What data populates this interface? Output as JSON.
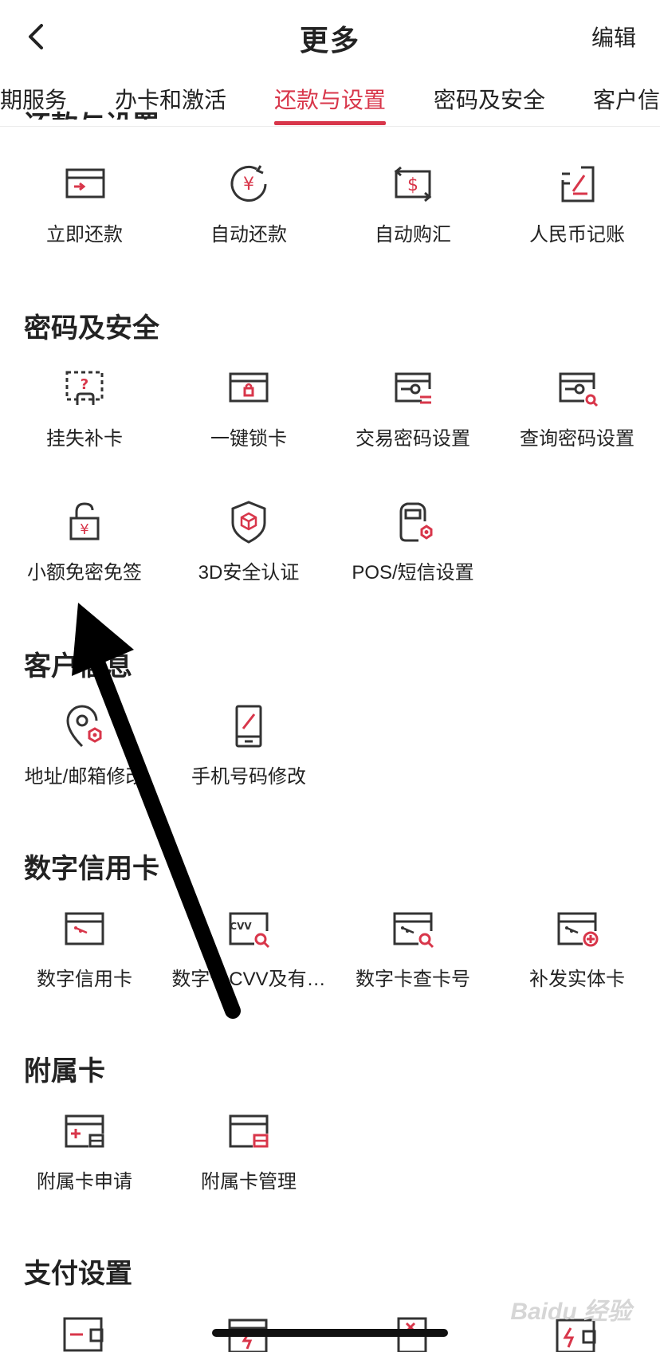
{
  "header": {
    "title": "更多",
    "edit_label": "编辑"
  },
  "tabs": [
    {
      "label": "期服务"
    },
    {
      "label": "办卡和激活"
    },
    {
      "label": "还款与设置",
      "active": true
    },
    {
      "label": "密码及安全"
    },
    {
      "label": "客户信"
    }
  ],
  "sections": {
    "repayment": {
      "title": "还款与设置",
      "items": [
        {
          "label": "立即还款",
          "icon": "repay-card-icon"
        },
        {
          "label": "自动还款",
          "icon": "auto-repay-yuan-icon"
        },
        {
          "label": "自动购汇",
          "icon": "auto-exchange-dollar-icon"
        },
        {
          "label": "人民币记账",
          "icon": "rmb-ledger-icon"
        }
      ]
    },
    "security": {
      "title": "密码及安全",
      "items": [
        {
          "label": "挂失补卡",
          "icon": "lost-card-icon"
        },
        {
          "label": "一键锁卡",
          "icon": "lock-card-icon"
        },
        {
          "label": "交易密码设置",
          "icon": "transaction-password-icon"
        },
        {
          "label": "查询密码设置",
          "icon": "query-password-icon"
        },
        {
          "label": "小额免密免签",
          "icon": "small-amount-unlock-icon"
        },
        {
          "label": "3D安全认证",
          "icon": "3d-secure-shield-icon"
        },
        {
          "label": "POS/短信设置",
          "icon": "pos-sms-icon"
        }
      ]
    },
    "customer": {
      "title": "客户信息",
      "items": [
        {
          "label": "地址/邮箱修改",
          "icon": "address-location-icon"
        },
        {
          "label": "手机号码修改",
          "icon": "phone-edit-icon"
        }
      ]
    },
    "digital": {
      "title": "数字信用卡",
      "items": [
        {
          "label": "数字信用卡",
          "icon": "digital-card-icon"
        },
        {
          "label": "数字卡CVV及有…",
          "icon": "cvv-search-icon"
        },
        {
          "label": "数字卡查卡号",
          "icon": "card-number-search-icon"
        },
        {
          "label": "补发实体卡",
          "icon": "reissue-card-icon"
        }
      ]
    },
    "supplementary": {
      "title": "附属卡",
      "items": [
        {
          "label": "附属卡申请",
          "icon": "supp-card-apply-icon"
        },
        {
          "label": "附属卡管理",
          "icon": "supp-card-manage-icon"
        }
      ]
    },
    "payment": {
      "title": "支付设置"
    }
  },
  "watermark": "Baidu 经验",
  "colors": {
    "accent": "#d8364a",
    "icon_dark": "#333333"
  }
}
